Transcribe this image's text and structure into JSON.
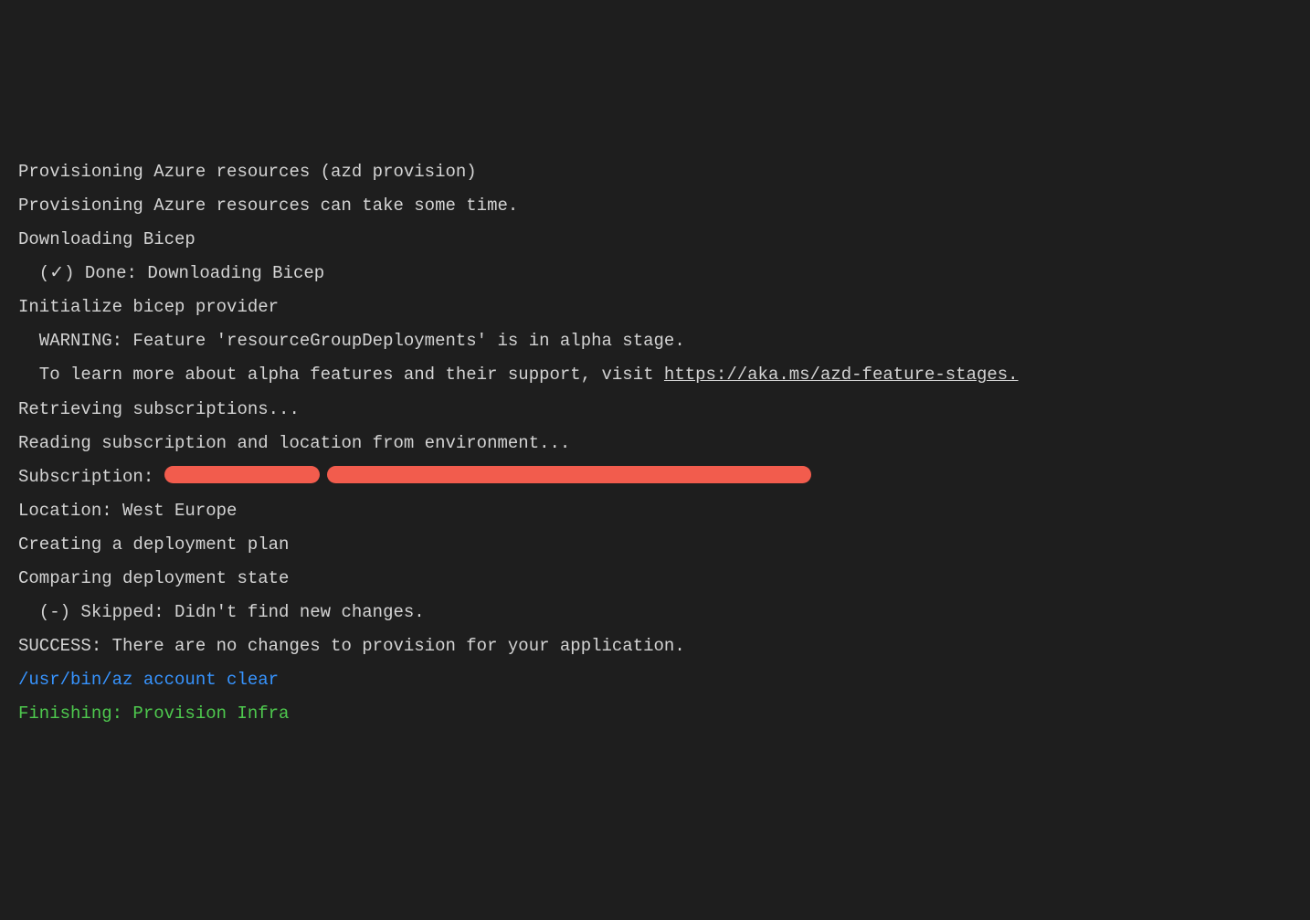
{
  "lines": {
    "l1": "Provisioning Azure resources (azd provision)",
    "l2": "Provisioning Azure resources can take some time.",
    "l3": "",
    "l4": "Downloading Bicep",
    "l5": "  (✓) Done: Downloading Bicep",
    "l6": "Initialize bicep provider",
    "l7": "",
    "l8": "  WARNING: Feature 'resourceGroupDeployments' is in alpha stage.",
    "l9a": "  To learn more about alpha features and their support, visit ",
    "l9b": "https://aka.ms/azd-feature-stages.",
    "l10": "",
    "l11": "Retrieving subscriptions...",
    "l12": "Reading subscription and location from environment...",
    "l13a": "Subscription: ",
    "l14": "Location: West Europe",
    "l15": "",
    "l16": "Creating a deployment plan",
    "l17": "Comparing deployment state",
    "l18": "  (-) Skipped: Didn't find new changes.",
    "l19": "",
    "l20": "SUCCESS: There are no changes to provision for your application.",
    "l21": "/usr/bin/az account clear",
    "l22": "Finishing: Provision Infra"
  }
}
